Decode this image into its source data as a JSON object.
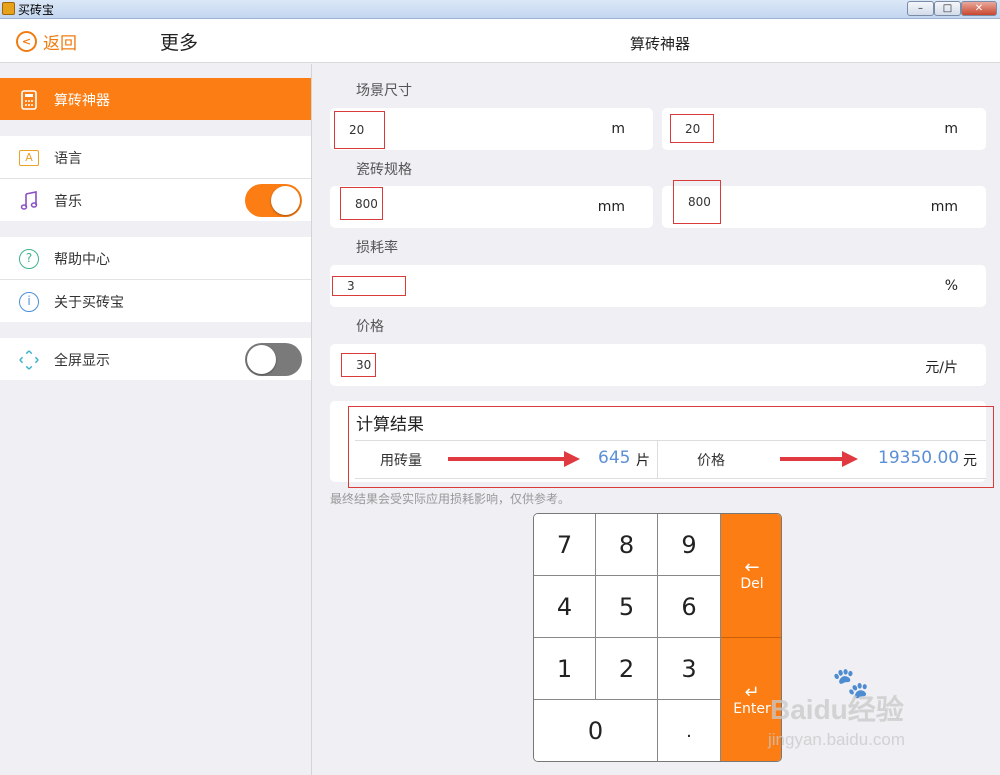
{
  "window": {
    "title": "买砖宝",
    "min": "–",
    "max": "□",
    "close": "✕"
  },
  "header": {
    "back_label": "返回",
    "more_title": "更多",
    "main_title": "算砖神器"
  },
  "sidebar": {
    "items": [
      {
        "label": "算砖神器",
        "icon": "calculator-icon"
      },
      {
        "label": "语言",
        "icon": "language-icon"
      },
      {
        "label": "音乐",
        "icon": "music-note-icon",
        "toggle": true
      },
      {
        "label": "帮助中心",
        "icon": "help-icon"
      },
      {
        "label": "关于买砖宝",
        "icon": "info-icon"
      },
      {
        "label": "全屏显示",
        "icon": "fullscreen-icon",
        "toggle": false
      }
    ],
    "icon_glyphs": {
      "language": "A",
      "help": "?",
      "info": "i"
    }
  },
  "calculator": {
    "scene_size": {
      "label": "场景尺寸",
      "width": "20",
      "length": "20",
      "unit": "m"
    },
    "tile_spec": {
      "label": "瓷砖规格",
      "width": "800",
      "length": "800",
      "unit": "mm"
    },
    "loss_rate": {
      "label": "损耗率",
      "value": "3",
      "unit": "%"
    },
    "price": {
      "label": "价格",
      "value": "30",
      "unit": "元/片"
    }
  },
  "result": {
    "title": "计算结果",
    "tiles_label": "用砖量",
    "tiles_value": "645",
    "tiles_unit": "片",
    "price_label": "价格",
    "price_value": "19350.00",
    "price_unit": "元",
    "note": "最终结果会受实际应用损耗影响，仅供参考。"
  },
  "keypad": {
    "keys": [
      "7",
      "8",
      "9",
      "4",
      "5",
      "6",
      "1",
      "2",
      "3",
      "0",
      "."
    ],
    "del_label": "Del",
    "del_arrow": "←",
    "enter_label": "Enter",
    "enter_arrow": "↵"
  },
  "watermark": {
    "main": "Baidu经验",
    "sub": "jingyan.baidu.com"
  },
  "colors": {
    "accent": "#fb7d14",
    "result_value": "#5b8fd6",
    "highlight": "#d93b3b"
  }
}
